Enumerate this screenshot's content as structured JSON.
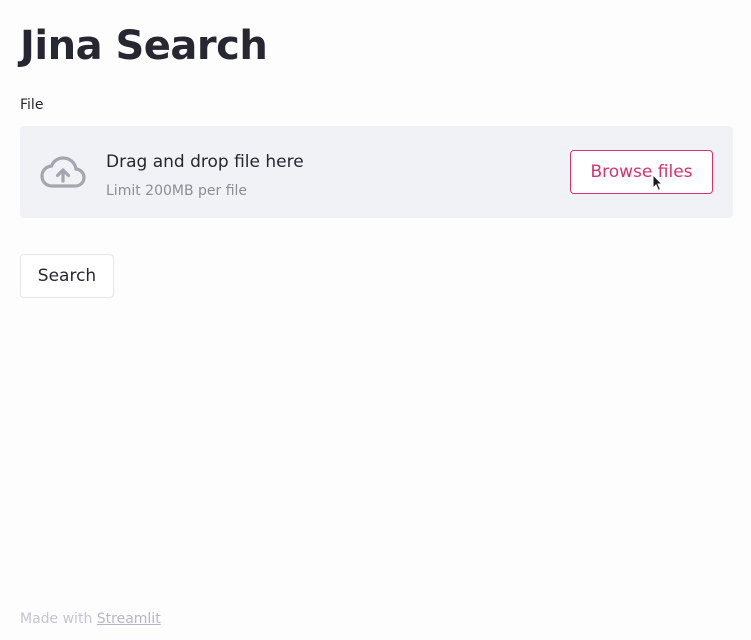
{
  "header": {
    "title": "Jina Search"
  },
  "uploader": {
    "label": "File",
    "drop_text": "Drag and drop file here",
    "limit_text": "Limit 200MB per file",
    "browse_label": "Browse files",
    "icon": "cloud-upload-icon"
  },
  "actions": {
    "search_label": "Search"
  },
  "footer": {
    "prefix": "Made with",
    "link": "Streamlit"
  },
  "colors": {
    "primary": "#d6336c",
    "text": "#262730",
    "dropzone_bg": "#f0f2f6",
    "muted": "#8c8e96"
  }
}
